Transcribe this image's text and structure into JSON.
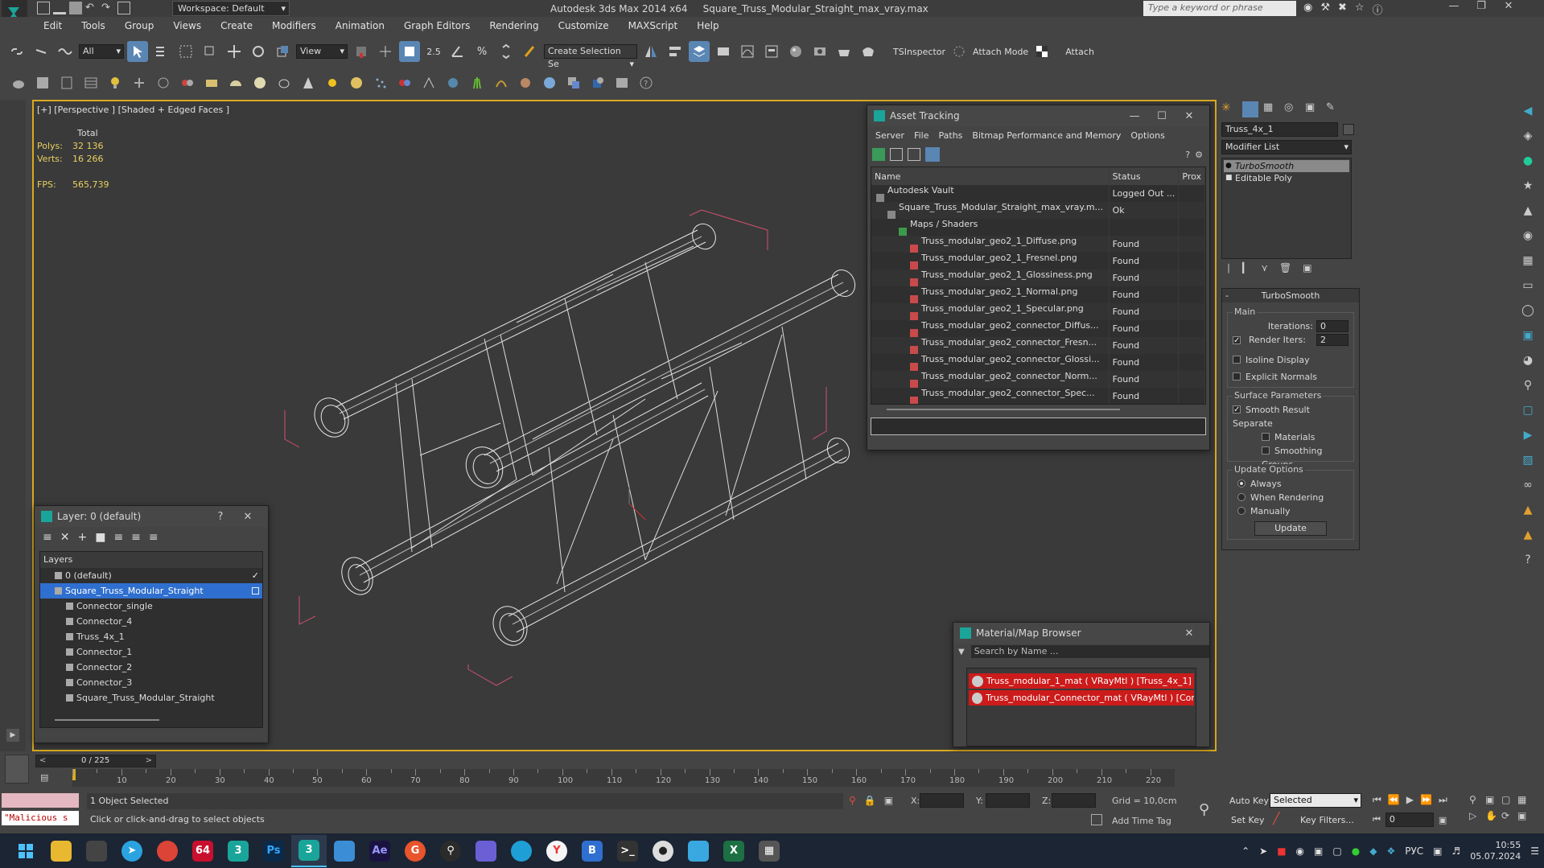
{
  "title_bar": {
    "workspace": "Workspace: Default",
    "app_title": "Autodesk 3ds Max  2014 x64",
    "file_title": "Square_Truss_Modular_Straight_max_vray.max",
    "search_placeholder": "Type a keyword or phrase"
  },
  "menu": [
    "Edit",
    "Tools",
    "Group",
    "Views",
    "Create",
    "Modifiers",
    "Animation",
    "Graph Editors",
    "Rendering",
    "Customize",
    "MAXScript",
    "Help"
  ],
  "toolbar": {
    "filter_select": "All",
    "coord_select": "View",
    "spinner_value": "2.5",
    "selection_set": "Create Selection Se",
    "tsinspector": "TSInspector",
    "attach_mode": "Attach Mode",
    "attach": "Attach"
  },
  "viewport": {
    "label": "[+] [Perspective ] [Shaded + Edged Faces ]",
    "stats_total": "Total",
    "polys_label": "Polys:",
    "polys_value": "32 136",
    "verts_label": "Verts:",
    "verts_value": "16 266",
    "fps_label": "FPS:",
    "fps_value": "565,739"
  },
  "asset_tracking": {
    "title": "Asset Tracking",
    "menu": [
      "Server",
      "File",
      "Paths",
      "Bitmap Performance and Memory",
      "Options"
    ],
    "columns": [
      "Name",
      "Status",
      "Prox"
    ],
    "rows": [
      {
        "name": "Autodesk Vault",
        "status": "Logged Out ...",
        "indent": 0,
        "icon": "vault-icon"
      },
      {
        "name": "Square_Truss_Modular_Straight_max_vray.m...",
        "status": "Ok",
        "indent": 1,
        "icon": "max-file-icon"
      },
      {
        "name": "Maps / Shaders",
        "status": "",
        "indent": 2,
        "icon": "folder-icon"
      },
      {
        "name": "Truss_modular_geo2_1_Diffuse.png",
        "status": "Found",
        "indent": 3,
        "icon": "png-icon"
      },
      {
        "name": "Truss_modular_geo2_1_Fresnel.png",
        "status": "Found",
        "indent": 3,
        "icon": "png-icon"
      },
      {
        "name": "Truss_modular_geo2_1_Glossiness.png",
        "status": "Found",
        "indent": 3,
        "icon": "png-icon"
      },
      {
        "name": "Truss_modular_geo2_1_Normal.png",
        "status": "Found",
        "indent": 3,
        "icon": "png-icon"
      },
      {
        "name": "Truss_modular_geo2_1_Specular.png",
        "status": "Found",
        "indent": 3,
        "icon": "png-icon"
      },
      {
        "name": "Truss_modular_geo2_connector_Diffus...",
        "status": "Found",
        "indent": 3,
        "icon": "png-icon"
      },
      {
        "name": "Truss_modular_geo2_connector_Fresn...",
        "status": "Found",
        "indent": 3,
        "icon": "png-icon"
      },
      {
        "name": "Truss_modular_geo2_connector_Glossi...",
        "status": "Found",
        "indent": 3,
        "icon": "png-icon"
      },
      {
        "name": "Truss_modular_geo2_connector_Norm...",
        "status": "Found",
        "indent": 3,
        "icon": "png-icon"
      },
      {
        "name": "Truss_modular_geo2_connector_Spec...",
        "status": "Found",
        "indent": 3,
        "icon": "png-icon"
      }
    ]
  },
  "layer_window": {
    "title": "Layer: 0 (default)",
    "help": "?",
    "header": "Layers",
    "rows": [
      {
        "name": "0 (default)",
        "indent": 1,
        "selected": false
      },
      {
        "name": "Square_Truss_Modular_Straight",
        "indent": 1,
        "selected": true
      },
      {
        "name": "Connector_single",
        "indent": 2,
        "selected": false
      },
      {
        "name": "Connector_4",
        "indent": 2,
        "selected": false
      },
      {
        "name": "Truss_4x_1",
        "indent": 2,
        "selected": false
      },
      {
        "name": "Connector_1",
        "indent": 2,
        "selected": false
      },
      {
        "name": "Connector_2",
        "indent": 2,
        "selected": false
      },
      {
        "name": "Connector_3",
        "indent": 2,
        "selected": false
      },
      {
        "name": "Square_Truss_Modular_Straight",
        "indent": 2,
        "selected": false
      }
    ]
  },
  "material_browser": {
    "title": "Material/Map Browser",
    "search_placeholder": "Search by Name ...",
    "items": [
      "Truss_modular_1_mat  ( VRayMtl ) [Truss_4x_1]",
      "Truss_modular_Connector_mat  ( VRayMtl ) [Con..."
    ]
  },
  "command_panel": {
    "object_name": "Truss_4x_1",
    "modifier_list": "Modifier List",
    "stack": [
      "TurboSmooth",
      "Editable Poly"
    ],
    "rollout_title": "TurboSmooth",
    "main_group": "Main",
    "iterations_label": "Iterations:",
    "iterations_value": "0",
    "render_iters_label": "Render Iters:",
    "render_iters_value": "2",
    "isoline_display": "Isoline Display",
    "explicit_normals": "Explicit Normals",
    "surface_params": "Surface Parameters",
    "smooth_result": "Smooth Result",
    "separate": "Separate",
    "materials": "Materials",
    "smoothing_groups": "Smoothing Groups",
    "update_options": "Update Options",
    "always": "Always",
    "when_rendering": "When Rendering",
    "manually": "Manually",
    "update_button": "Update"
  },
  "timeline": {
    "frame_counter": "0 / 225",
    "ticks": [
      "10",
      "20",
      "30",
      "40",
      "50",
      "60",
      "70",
      "80",
      "90",
      "100",
      "110",
      "120",
      "130",
      "140",
      "150",
      "160",
      "170",
      "180",
      "190",
      "200",
      "210",
      "220"
    ]
  },
  "status": {
    "script_listener": "\"Malicious s",
    "selected": "1 Object Selected",
    "prompt": "Click or click-and-drag to select objects",
    "x_label": "X:",
    "y_label": "Y:",
    "z_label": "Z:",
    "grid": "Grid = 10,0cm",
    "add_time_tag": "Add Time Tag",
    "auto_key": "Auto Key",
    "selected_mode": "Selected",
    "set_key": "Set Key",
    "key_filters": "Key Filters...",
    "frame_value": "0"
  },
  "taskbar": {
    "badge_64": "64",
    "lang": "РУС",
    "time": "10:55",
    "date": "05.07.2024"
  },
  "colors": {
    "accent_blue": "#5a86b4",
    "viewport_border": "#d9a920",
    "material_red": "#cc1b1b",
    "selected_layer": "#2f6fcf"
  }
}
